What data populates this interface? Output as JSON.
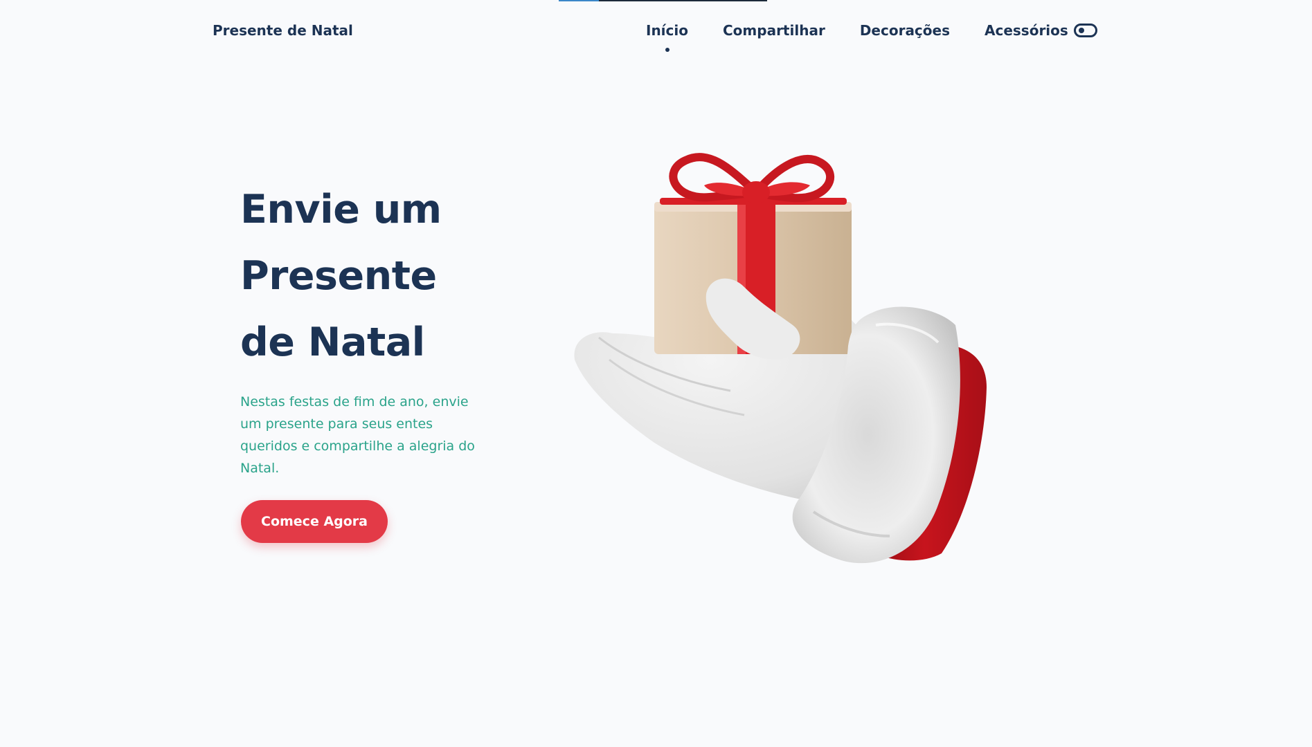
{
  "header": {
    "logo": "Presente de Natal",
    "nav": [
      {
        "label": "Início",
        "active": true
      },
      {
        "label": "Compartilhar",
        "active": false
      },
      {
        "label": "Decorações",
        "active": false
      },
      {
        "label": "Acessórios",
        "active": false
      }
    ],
    "theme_toggle_icon": "toggle-icon"
  },
  "hero": {
    "title_lines": [
      "Envie um",
      "Presente",
      "de Natal"
    ],
    "description": "Nestas festas de fim de ano, envie um presente para seus entes queridos e compartilhe a alegria do Natal.",
    "cta_label": "Comece Agora",
    "image_icon": "santa-hand-gift-image"
  },
  "colors": {
    "background": "#f9fafc",
    "title": "#1c3354",
    "description": "#2aa38a",
    "cta": "#e33a47",
    "ribbon": "#d81f26",
    "box": "#dcc6ab",
    "sleeve": "#c7141d",
    "glove": "#e9e9e9"
  }
}
